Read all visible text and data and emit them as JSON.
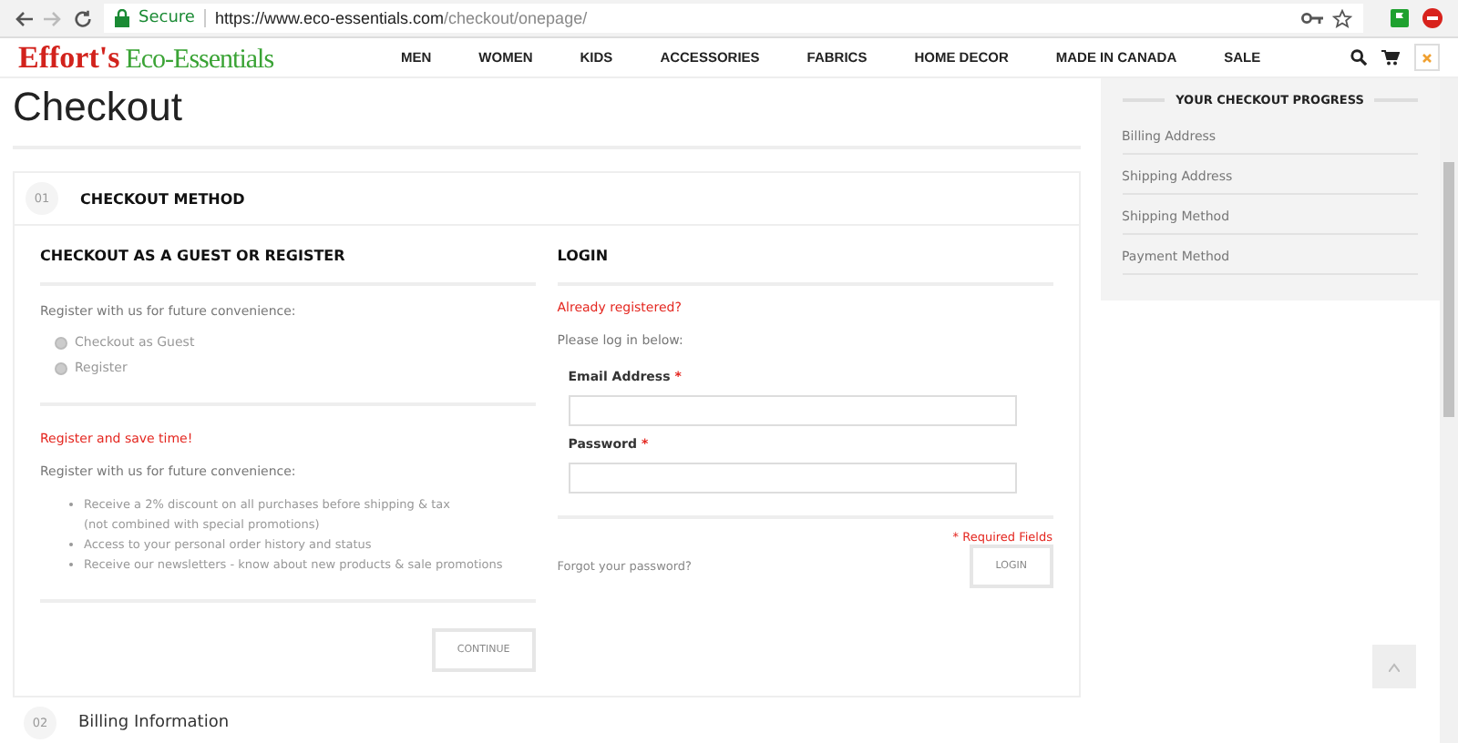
{
  "browser": {
    "secure_label": "Secure",
    "url_host": "https://www.eco-essentials.com",
    "url_path": "/checkout/onepage/"
  },
  "header": {
    "logo_main": "Effort's",
    "logo_sub": "Eco-Essentials",
    "nav": [
      "MEN",
      "WOMEN",
      "KIDS",
      "ACCESSORIES",
      "FABRICS",
      "HOME DECOR",
      "MADE IN CANADA",
      "SALE"
    ]
  },
  "page_title": "Checkout",
  "step": {
    "number": "01",
    "title": "CHECKOUT METHOD"
  },
  "guest": {
    "heading": "CHECKOUT AS A GUEST OR REGISTER",
    "intro": "Register with us for future convenience:",
    "options": [
      {
        "label": "Checkout as Guest",
        "selected": false
      },
      {
        "label": "Register",
        "selected": false
      }
    ],
    "save_heading": "Register and save time!",
    "save_intro": "Register with us for future convenience:",
    "benefits": [
      "Receive a 2% discount on all purchases before shipping & tax",
      "(not combined with special promotions)",
      "Access to your personal order history and status",
      "Receive our newsletters - know about new products & sale promotions"
    ],
    "continue_button": "CONTINUE"
  },
  "login": {
    "heading": "LOGIN",
    "already": "Already registered?",
    "prompt": "Please log in below:",
    "fields": [
      {
        "label": "Email Address",
        "required_mark": "*"
      },
      {
        "label": "Password",
        "required_mark": "*"
      }
    ],
    "required_note": "* Required Fields",
    "forgot_link": "Forgot your password?",
    "login_button": "LOGIN"
  },
  "next_step": {
    "number": "02",
    "title": "Billing Information"
  },
  "progress": {
    "title": "YOUR CHECKOUT PROGRESS",
    "items": [
      "Billing Address",
      "Shipping Address",
      "Shipping Method",
      "Payment Method"
    ]
  }
}
